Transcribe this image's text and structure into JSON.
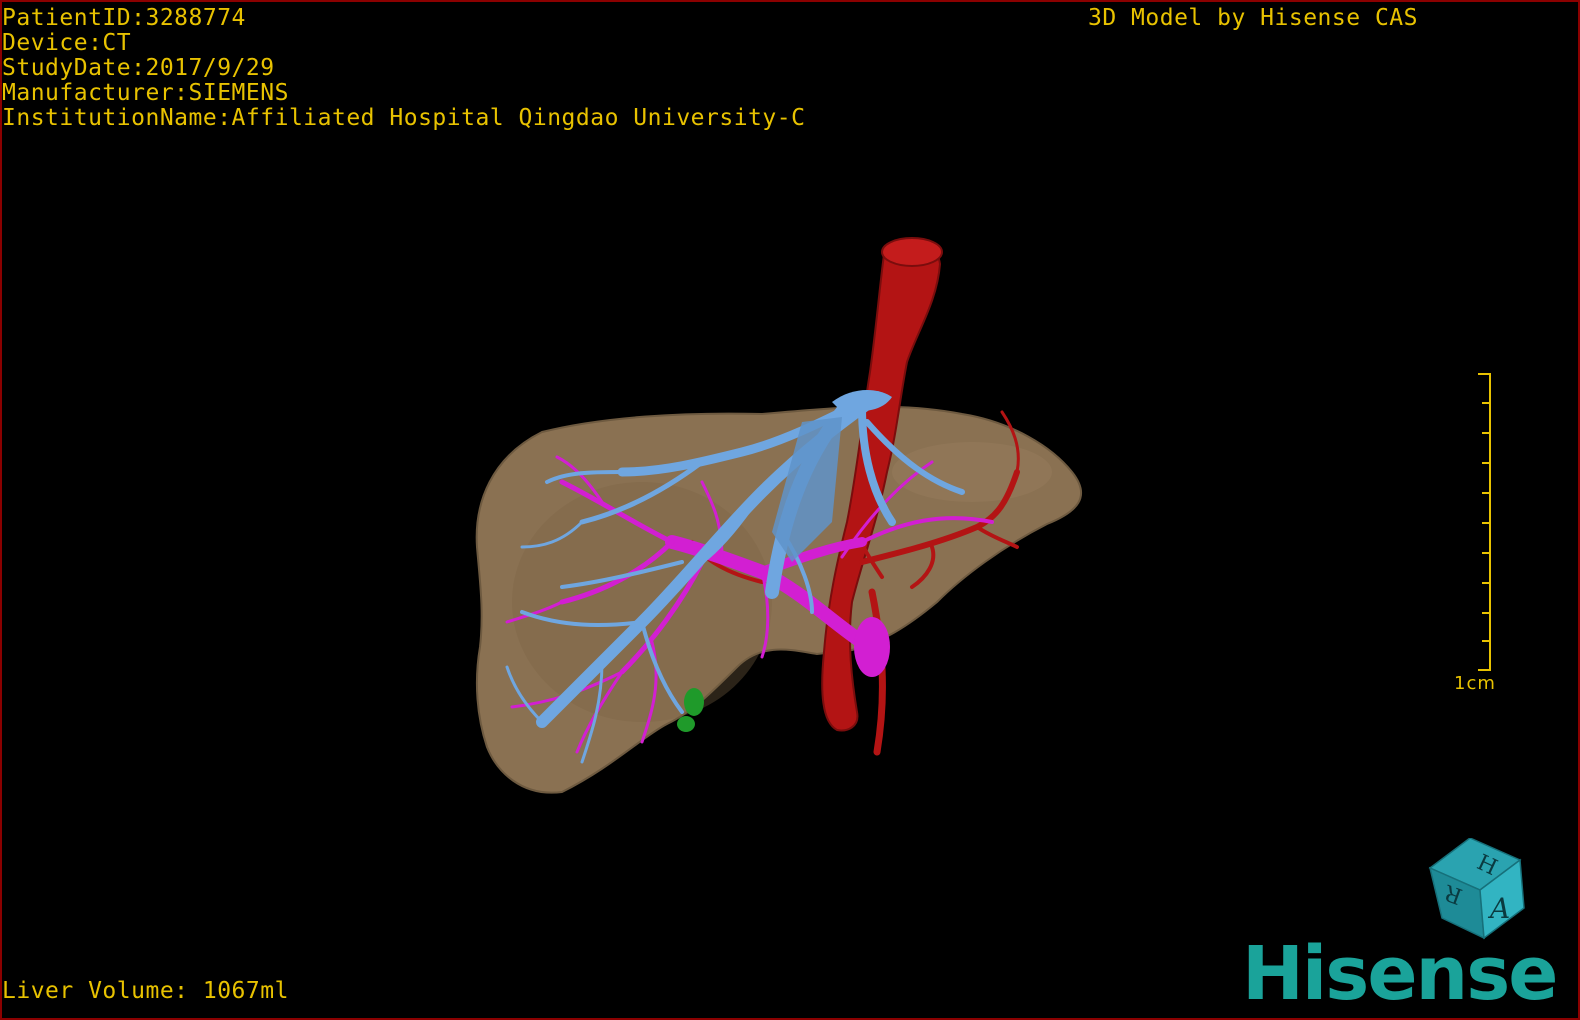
{
  "overlay": {
    "patient_id": "PatientID:3288774",
    "device": "Device:CT",
    "study_date": "StudyDate:2017/9/29",
    "manufacturer": "Manufacturer:SIEMENS",
    "institution": "InstitutionName:Affiliated Hospital Qingdao University-C",
    "credit": "3D Model by Hisense CAS",
    "liver_volume": "Liver Volume: 1067ml"
  },
  "scale": {
    "label": "1cm"
  },
  "orientation_cube": {
    "top_face": "H",
    "side_face": "R",
    "front_face": "A"
  },
  "logo": {
    "text": "Hisense"
  },
  "colors": {
    "overlay_text": "#e8c200",
    "liver": "#8a7152",
    "hepatic_vein": "#6fa6e0",
    "portal_vein": "#d21fd2",
    "artery_ivc": "#b31414",
    "lesion": "#1f9a2a",
    "logo": "#1aa39a",
    "frame": "#8b0000"
  }
}
